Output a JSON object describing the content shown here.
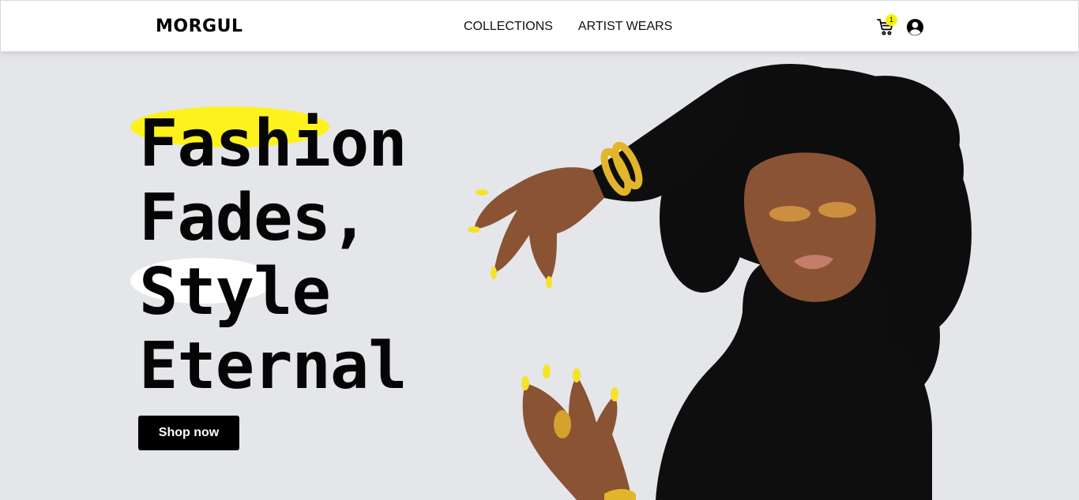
{
  "brand": {
    "name": "MORGUL"
  },
  "nav": {
    "links": [
      {
        "label": "COLLECTIONS"
      },
      {
        "label": "ARTIST WEARS"
      }
    ]
  },
  "cart": {
    "count": "1",
    "icon": "cart-icon"
  },
  "account": {
    "icon": "user-circle-icon"
  },
  "hero": {
    "headline": [
      "Fashion",
      "Fades,",
      "Style",
      "Eternal"
    ],
    "cta_label": "Shop now",
    "image": "model-with-afro-black-turtleneck"
  },
  "colors": {
    "accent_yellow": "#fdf21b",
    "background": "#e4e6ea",
    "button": "#000000"
  }
}
